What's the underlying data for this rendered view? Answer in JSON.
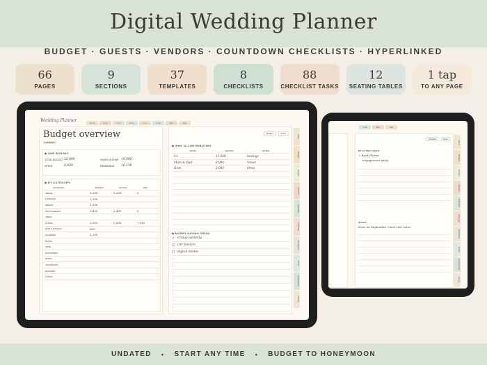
{
  "header": {
    "title": "Digital Wedding Planner",
    "subtitle": "BUDGET · GUESTS · VENDORS · COUNTDOWN CHECKLISTS · HYPERLINKED"
  },
  "stats": [
    {
      "num": "66",
      "label": "PAGES",
      "color": "#ede0cc"
    },
    {
      "num": "9",
      "label": "SECTIONS",
      "color": "#d6e3d8"
    },
    {
      "num": "37",
      "label": "TEMPLATES",
      "color": "#f1dfcd"
    },
    {
      "num": "8",
      "label": "CHECKLISTS",
      "color": "#cfdfd2"
    },
    {
      "num": "88",
      "label": "CHECKLIST TASKS",
      "color": "#f1dcd0"
    },
    {
      "num": "12",
      "label": "SEATING TABLES",
      "color": "#dce5df"
    },
    {
      "num": "1 tap",
      "label": "TO ANY PAGE",
      "color": "#f5e9dc"
    }
  ],
  "footer": {
    "items": [
      "UNDATED",
      "START ANY TIME",
      "BUDGET TO HONEYMOON"
    ],
    "separator": "•"
  },
  "front": {
    "brand": "Wedding Planner",
    "top_tabs": [
      "12 mo",
      "9 mo",
      "6 mo",
      "3 mo",
      "1 mo",
      "1 wk",
      "Eve",
      "Day"
    ],
    "top_tab_colors": [
      "#efe0c8",
      "#f1d8cc",
      "#efe0c8",
      "#d9e5da",
      "#efe0c8",
      "#d9e5da",
      "#f1d8cc",
      "#efe0c8"
    ],
    "side_tabs": [
      "Index",
      "Budget",
      "Guests",
      "Vendors",
      "Checklist",
      "Calendar",
      "Reception",
      "Notes",
      "Honeymoon",
      "Extras"
    ],
    "side_tab_colors": [
      "#efe4d2",
      "#f1dfc4",
      "#e8ecd8",
      "#f0d9cb",
      "#d7e5d6",
      "#f1dccf",
      "#e6e2d6",
      "#dfe8e0",
      "#d3e3da",
      "#f0e4d4"
    ],
    "page_title": "Budget overview",
    "page_sub": "A BUDGET",
    "buttons": [
      "Budget",
      "Index"
    ],
    "our_budget": {
      "heading": "OUR BUDGET",
      "rows": [
        {
          "label": "TOTAL BUDGET",
          "value": "25,000",
          "label2": "SAVED SO FAR",
          "value2": "19,500"
        },
        {
          "label": "SPENT",
          "value": "8,850",
          "label2": "REMAINING",
          "value2": "16,150"
        }
      ]
    },
    "category": {
      "heading": "BY CATEGORY",
      "columns": [
        "CATEGORY",
        "BUDGET",
        "ACTUAL",
        "DIFF"
      ],
      "rows": [
        [
          "VENUE",
          "5,000",
          "5,000",
          "0"
        ],
        [
          "CATERING",
          "2,300",
          "",
          ""
        ],
        [
          "DRINKS",
          "1,100",
          "",
          ""
        ],
        [
          "PHOTOGRAPHY",
          "2,450",
          "2,450",
          "0"
        ],
        [
          "VIDEO",
          "",
          "",
          ""
        ],
        [
          "ATTIRE",
          "2,000",
          "2,650",
          "+150"
        ],
        [
          "HAIR & MAKEUP",
          "600",
          "",
          ""
        ],
        [
          "FLOWERS",
          "1,200",
          "",
          ""
        ],
        [
          "MUSIC",
          "",
          "",
          ""
        ],
        [
          "CAKE",
          "",
          "",
          ""
        ],
        [
          "STATIONERY",
          "",
          "",
          ""
        ],
        [
          "RINGS",
          "",
          "",
          ""
        ],
        [
          "TRANSPORT",
          "",
          "",
          ""
        ],
        [
          "FAVOURS",
          "",
          "",
          ""
        ],
        [
          "OTHER",
          "",
          "",
          ""
        ]
      ]
    },
    "contributing": {
      "heading": "WHO IS CONTRIBUTING",
      "columns": [
        "FROM",
        "AMOUNT",
        "NOTES"
      ],
      "rows": [
        [
          "Us",
          "12,500",
          "Savings"
        ],
        [
          "Mum & Dad",
          "8,000",
          "Venue"
        ],
        [
          "Gran",
          "2,000",
          "dress"
        ]
      ]
    },
    "saving": {
      "heading": "MONEY SAVING IDEAS",
      "items": [
        {
          "text": "Friday wedding",
          "checked": true
        },
        {
          "text": "DIY favours",
          "checked": false
        },
        {
          "text": "digital invites",
          "checked": false
        }
      ]
    }
  },
  "back": {
    "header_tabs": [
      "1 wk",
      "Eve",
      "Day"
    ],
    "buttons": [
      "Checklist",
      "Index"
    ],
    "extras_heading": "MY EXTRA TASKS",
    "extras": [
      {
        "text": "Book Florist",
        "checked": true
      },
      {
        "text": "engagement party",
        "checked": false
      }
    ],
    "notes_heading": "NOTES",
    "note": "Done on September! more text notes",
    "side_tabs": [
      "Index",
      "Budget",
      "Guests",
      "Vendors",
      "Checklist",
      "Calendar",
      "Reception",
      "Notes",
      "Honeymoon",
      "Extras"
    ]
  }
}
